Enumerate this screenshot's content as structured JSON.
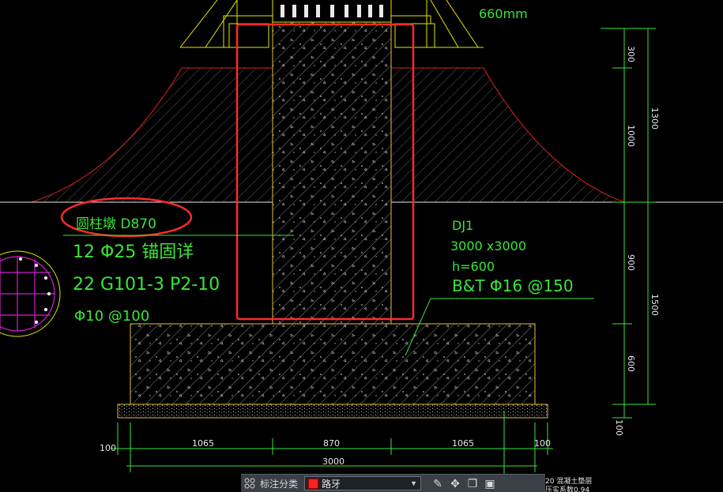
{
  "labels": {
    "top_dim": "660mm",
    "pier_name": "圆柱墩  D870",
    "rebar_main": "12 Φ25   锚固详",
    "rebar_ref": "22 G101-3 P2-10",
    "rebar_stirrup": "Φ10 @100",
    "footing_id": "DJ1",
    "footing_size": "3000 x3000",
    "footing_h": "h=600",
    "footing_rebar": "B&T  Φ16 @150",
    "note_small_1": "20 混凝土垫层",
    "note_small_2": "压实系数0.94"
  },
  "dims_bottom": {
    "left_100": "100",
    "d1065_a": "1065",
    "d870": "870",
    "d1065_b": "1065",
    "right_100": "100",
    "total": "3000"
  },
  "dims_right": {
    "d300": "300",
    "d1000": "1000",
    "d1300": "1300",
    "d900": "900",
    "d1500": "1500",
    "d600": "600",
    "d100": "100"
  },
  "toolbar": {
    "icon_grid": "grid-icon",
    "label": "标注分类",
    "selected": "路牙",
    "swatch_color": "#ff2020",
    "icons": [
      "edit-icon",
      "move-icon",
      "copy-icon",
      "paste-icon"
    ]
  }
}
